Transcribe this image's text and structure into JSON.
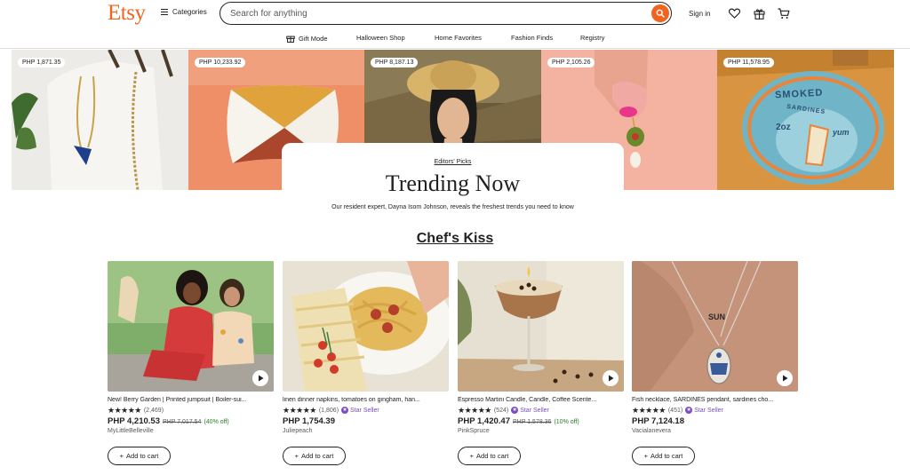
{
  "header": {
    "logo": "Etsy",
    "categories_label": "Categories",
    "search_placeholder": "Search for anything",
    "signin_label": "Sign in"
  },
  "nav": [
    {
      "label": "Gift Mode"
    },
    {
      "label": "Halloween Shop"
    },
    {
      "label": "Home Favorites"
    },
    {
      "label": "Fashion Finds"
    },
    {
      "label": "Registry"
    }
  ],
  "hero": {
    "prices": [
      "PHP 1,871.35",
      "PHP 10,233.92",
      "PHP 8,187.13",
      "PHP 2,105.26",
      "PHP 11,578.95"
    ],
    "patch_text": {
      "line1": "SMOKED",
      "line2": "SARDINES",
      "line3": "2oz",
      "line4": "yum"
    },
    "editors_picks": "Editors' Picks",
    "title": "Trending Now",
    "description": "Our resident expert, Dayna Isom Johnson, reveals the freshest trends you need to know"
  },
  "section_title": "Chef's Kiss",
  "products": [
    {
      "title": "New! Berry Garden | Printed jumpsuit | Boiler-sui...",
      "reviews": "(2,469)",
      "star_seller": "",
      "price": "PHP 4,210.53",
      "original": "PHP 7,017.54",
      "discount": "(40% off)",
      "shop": "MyLittleBelleville",
      "cart_label": "Add to cart",
      "has_video": true
    },
    {
      "title": "linen dinner napkins, tomatoes on gingham, han...",
      "reviews": "(1,806)",
      "star_seller": "Star Seller",
      "price": "PHP 1,754.39",
      "original": "",
      "discount": "",
      "shop": "Juliepeach",
      "cart_label": "Add to cart",
      "has_video": false
    },
    {
      "title": "Espresso Martini Candle, Candle, Coffee Scente...",
      "reviews": "(524)",
      "star_seller": "Star Seller",
      "price": "PHP 1,420.47",
      "original": "PHP 1,578.36",
      "discount": "(10% off)",
      "shop": "PinkSpruce",
      "cart_label": "Add to cart",
      "has_video": true
    },
    {
      "title": "Fish necklace, SARDINES pendant, sardines cho...",
      "reviews": "(451)",
      "star_seller": "Star Seller",
      "price": "PHP 7,124.18",
      "original": "",
      "discount": "",
      "shop": "Vacialanevera",
      "cart_label": "Add to cart",
      "has_video": true
    }
  ],
  "necklace_text": "SUN",
  "colors": {
    "brand": "#f1641e",
    "star_seller": "#7b4dc7",
    "discount": "#2d7a2d"
  }
}
